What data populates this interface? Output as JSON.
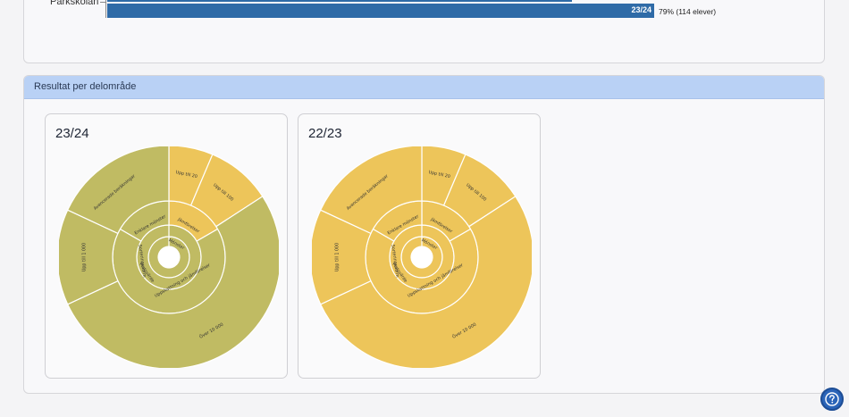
{
  "top_chart": {
    "school": "Parkskolan",
    "bar_label": "23/24",
    "bar_value": "79% (114 elever)",
    "value_percent": 79
  },
  "section": {
    "title": "Resultat per delområde"
  },
  "charts": [
    {
      "title": "23/24",
      "colors": {
        "olive": "#c0bb63",
        "yellow": "#edc55a"
      },
      "highlight": "olive"
    },
    {
      "title": "22/23",
      "colors": {
        "olive": "#edc55a",
        "yellow": "#edc55a"
      },
      "highlight": "yellow"
    }
  ],
  "segments": {
    "inner": "Mönster",
    "middle_1": "Enklare mönster",
    "middle_2": "Jämförelser",
    "middle_3": "Sorteringsnorm",
    "middle_4": "Platsvärde",
    "middle_5": "Uppskattning och jämförelser",
    "outer_1": "Upp till 20",
    "outer_2": "Upp till 100",
    "outer_3": "Upp till 1 000",
    "outer_4": "Avancerade beräkningar",
    "outer_5": "Över 10 000"
  },
  "help": {
    "icon": "question-icon"
  }
}
